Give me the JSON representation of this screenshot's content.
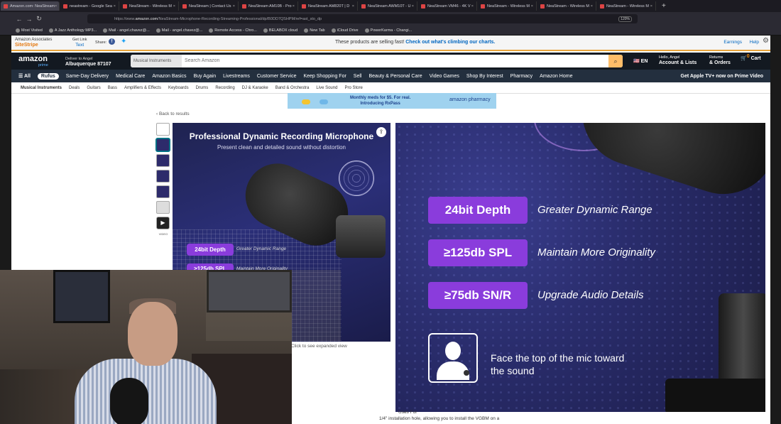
{
  "browser": {
    "tabs": [
      {
        "label": "Amazon.com: NeaStream"
      },
      {
        "label": "neastream - Google Sea"
      },
      {
        "label": "NeaStream - Wireless M"
      },
      {
        "label": "NeaStream | Contact Us"
      },
      {
        "label": "NeaStream AM10B - Pro"
      },
      {
        "label": "NeaStream AM820T | D"
      },
      {
        "label": "NeaStream AWM10T - U"
      },
      {
        "label": "NeaStream VM46 - 4K V"
      },
      {
        "label": "NeaStream - Wireless M"
      },
      {
        "label": "NeaStream - Wireless M"
      },
      {
        "label": "NeaStream - Wireless M"
      }
    ],
    "new_tab": "+",
    "url_prefix": "https://www.",
    "url_domain": "amazon.com",
    "url_rest": "/NeaStream-Microphone-Recording-Streaming-Professional/dp/B0DD7QSHPM/ref=ast_sto_dp",
    "zoom": "120%",
    "bookmarks": [
      "Most Visited",
      "A Jazz Anthology MP3...",
      "Mail - angel.chavez@...",
      "Mail - angel.chavez@...",
      "Remote Access - Chro...",
      "BELABOX cloud",
      "New Tab",
      "iCloud Drive",
      "PowerKarma - Changi..."
    ]
  },
  "associates": {
    "label1": "Amazon Associates",
    "label2": "SiteStripe",
    "getlink": "Get Link",
    "text": "Text",
    "share": "Share:",
    "message": "These products are selling fast!",
    "message_link": "Check out what's climbing our charts.",
    "earnings": "Earnings",
    "help": "Help"
  },
  "header": {
    "logo": "amazon",
    "logo_sub": "prime",
    "deliver_label": "Deliver to Angel",
    "deliver_loc": "Albuquerque 87107",
    "search_category": "Musical Instruments",
    "search_placeholder": "Search Amazon",
    "lang": "EN",
    "account_hello": "Hello, Angel",
    "account_label": "Account & Lists",
    "returns_label": "Returns",
    "orders_label": "& Orders",
    "cart_count": "0",
    "cart_label": "Cart"
  },
  "nav": {
    "all": "All",
    "rufus": "Rufus",
    "items": [
      "Same-Day Delivery",
      "Medical Care",
      "Amazon Basics",
      "Buy Again",
      "Livestreams",
      "Customer Service",
      "Keep Shopping For",
      "Sell",
      "Beauty & Personal Care",
      "Video Games",
      "Shop By Interest",
      "Pharmacy",
      "Amazon Home"
    ],
    "prime_promo": "Get Apple TV+ now on Prime Video"
  },
  "subnav": {
    "items": [
      "Musical Instruments",
      "Deals",
      "Guitars",
      "Bass",
      "Amplifiers & Effects",
      "Keyboards",
      "Drums",
      "Recording",
      "DJ & Karaoke",
      "Band & Orchestra",
      "Live Sound",
      "Pro Store"
    ]
  },
  "pharmacy_banner": {
    "line1": "Monthly meds for $5. For real.",
    "line2": "Introducing RxPass",
    "brand": "amazon pharmacy"
  },
  "product": {
    "back": "‹ Back to results",
    "video_label": "VIDEO",
    "main_title": "Professional Dynamic Recording Microphone",
    "main_subtitle": "Present clean and detailed sound without distortion",
    "expanded": "Click to see expanded view",
    "features": [
      {
        "badge": "24bit Depth",
        "desc": "Greater Dynamic Range"
      },
      {
        "badge": "≥125db SPL",
        "desc": "Maintain More Originality"
      },
      {
        "badge": "≥75db SN/R",
        "desc": "Upgrade Audio Details"
      }
    ],
    "tip": "Face the top of the mic toward the sound",
    "below1": "Uses For",
    "below2": "1/4\" installation hole, allowing you to install the VGBM on a"
  },
  "colors": {
    "badge": "#8a3cdc",
    "amazon_dark": "#131921",
    "amazon_nav": "#232f3e",
    "search_btn": "#febd69"
  }
}
